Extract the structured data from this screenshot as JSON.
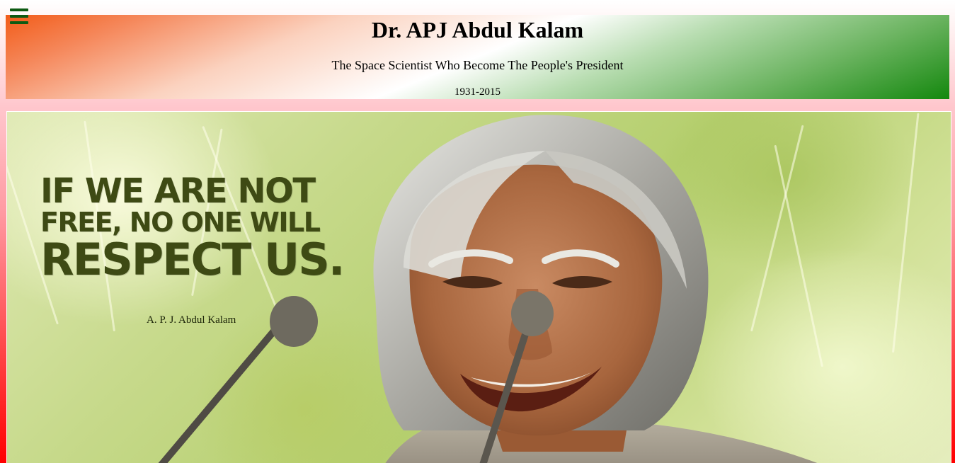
{
  "header": {
    "title": "Dr. APJ Abdul Kalam",
    "tagline": "The Space Scientist Who Become The People's President",
    "years": "1931-2015"
  },
  "hero": {
    "quote_line1": "If we are not",
    "quote_line2": "free, no one will",
    "quote_line3": "respect us.",
    "quote_author": "A. P. J. Abdul Kalam"
  },
  "icons": {
    "menu": "hamburger-menu-icon"
  },
  "colors": {
    "saffron": "#f25c19",
    "green": "#14880e",
    "menu_icon": "#0d5a12",
    "quote_text": "#3e4a14"
  }
}
